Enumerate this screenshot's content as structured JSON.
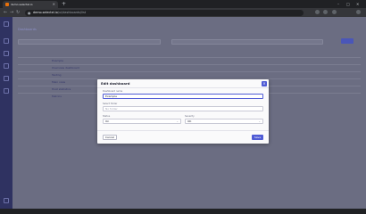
{
  "browser": {
    "tab_title": "demo.selectel.io",
    "url_host": "demo.selectel.io",
    "url_path": "/ui/dashboards/list",
    "new_tab_glyph": "+",
    "close_glyph": "×"
  },
  "page": {
    "breadcrumb": "Dashboards"
  },
  "table": {
    "rows": [
      {
        "name": "Example"
      },
      {
        "name": "Overview dashboard"
      },
      {
        "name": "Testing"
      },
      {
        "name": "Main view"
      },
      {
        "name": "Host statistics"
      },
      {
        "name": "Metrics"
      }
    ]
  },
  "modal": {
    "title": "Edit dashboard",
    "close_glyph": "×",
    "fields": {
      "name": {
        "label": "Dashboard name",
        "value": "Example"
      },
      "group": {
        "label": "Select folder",
        "placeholder": "No folder"
      },
      "status": {
        "label": "Status",
        "value": "On"
      },
      "severity": {
        "label": "Severity",
        "value": "OK"
      }
    },
    "cancel_label": "Cancel",
    "save_label": "Save"
  },
  "colors": {
    "accent": "#4f5bd5",
    "overlay": "#6b6d82",
    "sidebar": "#2f3261"
  }
}
